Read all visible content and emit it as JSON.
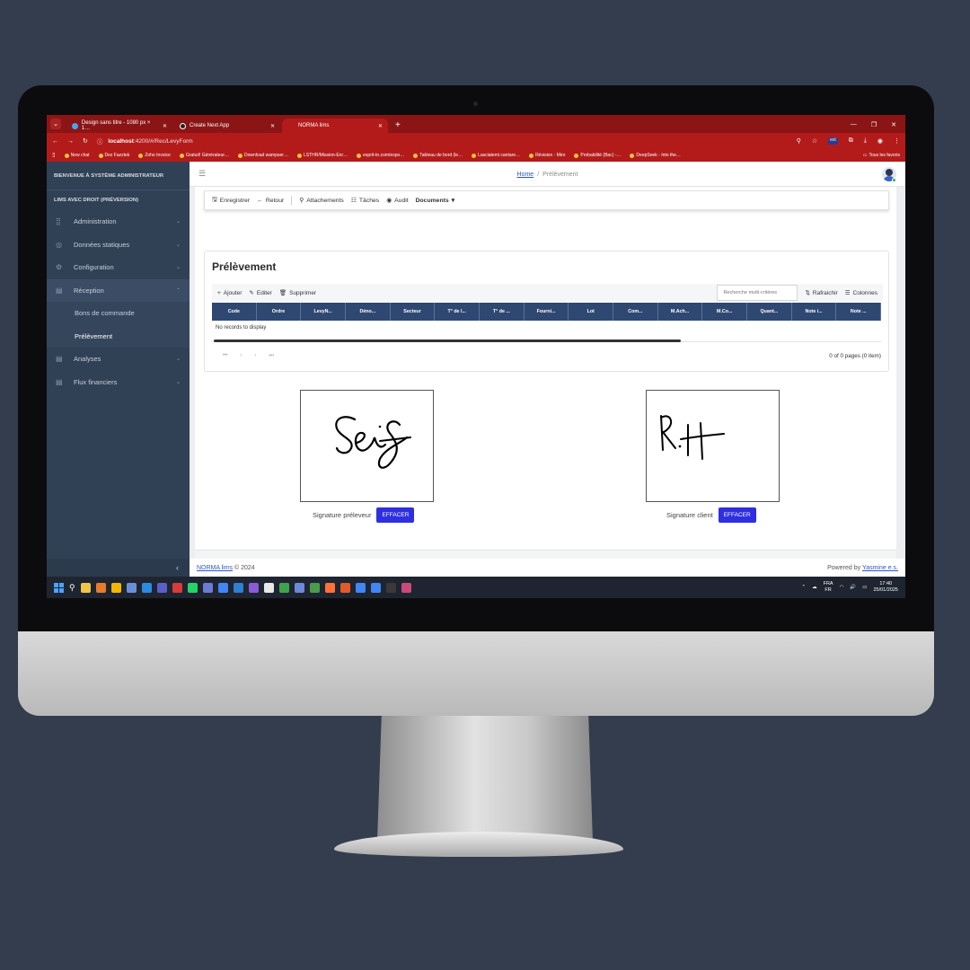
{
  "browser": {
    "tabs": [
      {
        "label": "Design sans titre - 1080 px × 1…",
        "active": false
      },
      {
        "label": "Create Next App",
        "active": false
      },
      {
        "label": "NORMA lims",
        "active": true
      }
    ],
    "new_tab": "+",
    "url_host": "localhost",
    "url_path": ":4200/#/Rec/LevyForm",
    "bookmarks": [
      "New chat",
      "Dez Fazztek",
      "Zoho Invoice",
      "Gratuit! Générateur…",
      "Download wampser…",
      "LSTHR/Mission-Enr…",
      "esprit-tn.com/espo…",
      "Tableau de bord (le…",
      "Lasciatemi cantare…",
      "Révision - Miro",
      "Probabilité (Bac) -…",
      "DeepSeek - Into the…"
    ],
    "all_favorites": "Tous les favoris"
  },
  "sidebar": {
    "brand": "BIENVENUE À SYSTÈME ADMINISTRATEUR",
    "section": "LIMS AVEC DROIT (PRÉVERSION)",
    "items": [
      {
        "label": "Administration",
        "icon": "grid-icon"
      },
      {
        "label": "Données statiques",
        "icon": "database-icon"
      },
      {
        "label": "Configuration",
        "icon": "gear-icon"
      },
      {
        "label": "Réception",
        "icon": "inbox-icon"
      }
    ],
    "sub_items": [
      "Bons de commande",
      "Prélèvement"
    ],
    "items_after": [
      {
        "label": "Analyses",
        "icon": "table-icon"
      },
      {
        "label": "Flux financiers",
        "icon": "table-icon"
      }
    ]
  },
  "topbar": {
    "breadcrumb_home": "Home",
    "breadcrumb_sep": "/",
    "breadcrumb_current": "Prélèvement"
  },
  "action_bar": {
    "save": "Enregistrer",
    "back": "Retour",
    "attachments": "Attachements",
    "tasks": "Tâches",
    "audit": "Audit",
    "documents": "Documents"
  },
  "card": {
    "title": "Prélèvement",
    "toolbar": {
      "add": "Ajouter",
      "edit": "Editer",
      "delete": "Supprimer",
      "search_placeholder": "Recherche multi-critères",
      "refresh": "Rafraichir",
      "columns": "Colonnes"
    },
    "columns": [
      "Code",
      "Ordre",
      "LevyN...",
      "Déno...",
      "Secteur",
      "T° de l...",
      "T° de ...",
      "Fourni...",
      "Lot",
      "Com...",
      "M.Ach...",
      "M.Co...",
      "Quant...",
      "Note i...",
      "Note ..."
    ],
    "empty_text": "No records to display",
    "pager_info": "0 of 0 pages (0 item)"
  },
  "signatures": [
    {
      "label": "Signature préleveur",
      "button": "EFFACER"
    },
    {
      "label": "Signature client",
      "button": "EFFACER"
    }
  ],
  "footer": {
    "app_name": "NORMA lims",
    "copyright": "© 2024",
    "powered_by": "Powered by",
    "vendor": "Yasmine e.s."
  },
  "taskbar": {
    "language": "FRA",
    "locale": "FR",
    "time": "17:40",
    "date": "25/01/2025"
  },
  "colors": {
    "browser_red": "#b31b1b",
    "sidebar_bg": "#314155",
    "grid_header": "#2f4872",
    "button_blue": "#2f2fe0"
  }
}
